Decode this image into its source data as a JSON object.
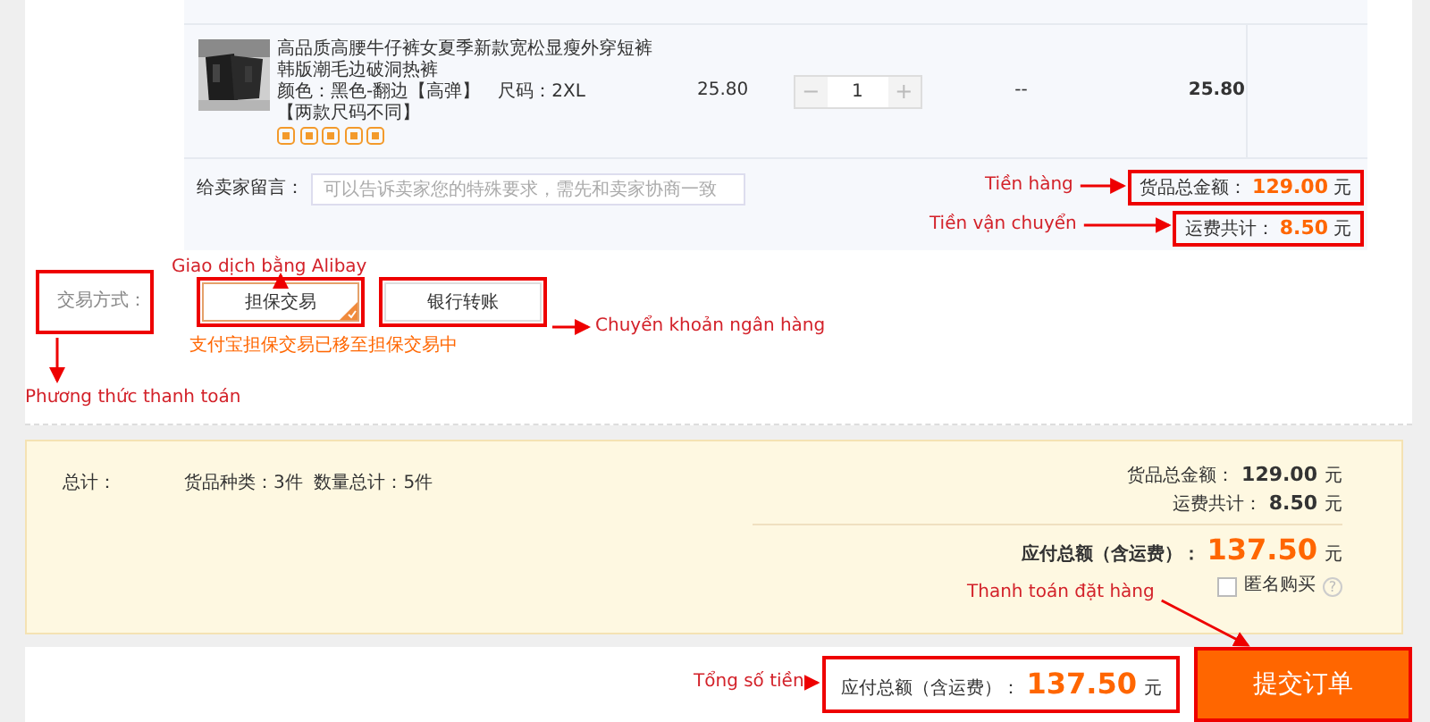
{
  "product": {
    "title": "高品质高腰牛仔裤女夏季新款宽松显瘦外穿短裤韩版潮毛边破洞热裤",
    "color_attr": "颜色：黑色-翻边【高弹】",
    "size_attr": "尺码：2XL",
    "note": "【两款尺码不同】",
    "price": "25.80",
    "quantity": "1",
    "minus": "−",
    "plus": "+",
    "discount": "--",
    "subtotal": "25.80"
  },
  "message": {
    "label": "给卖家留言：",
    "placeholder": "可以告诉卖家您的特殊要求，需先和卖家协商一致"
  },
  "order_totals": [
    {
      "label": "货品总金额：",
      "amount": "129.00",
      "unit": "元"
    },
    {
      "label": "运费共计：",
      "amount": "8.50",
      "unit": "元"
    }
  ],
  "payment": {
    "label": "交易方式：",
    "options": [
      {
        "label": "担保交易",
        "selected": true
      },
      {
        "label": "银行转账",
        "selected": false
      }
    ],
    "note": "支付宝担保交易已移至担保交易中"
  },
  "summary": {
    "label": "总计：",
    "counts": "货品种类：3件  数量总计：5件",
    "lines": [
      {
        "label": "货品总金额：",
        "amount": "129.00",
        "unit": "元"
      },
      {
        "label": "运费共计：",
        "amount": "8.50",
        "unit": "元"
      }
    ],
    "total": {
      "label": "应付总额（含运费）：",
      "amount": "137.50",
      "unit": "元"
    },
    "anonymous": {
      "label": "匿名购买",
      "checked": false,
      "help": "?"
    }
  },
  "footer": {
    "total_label": "应付总额（含运费）：",
    "total_amount": "137.50",
    "total_unit": "元",
    "submit": "提交订单"
  },
  "annotations": [
    {
      "text": "Tiền hàng"
    },
    {
      "text": "Tiền vận chuyển"
    },
    {
      "text": "Giao dịch bằng Alibay"
    },
    {
      "text": "Chuyển khoản ngân hàng"
    },
    {
      "text": "Phương thức thanh toán"
    },
    {
      "text": "Thanh toán đặt hàng"
    },
    {
      "text": "Tổng số tiền"
    }
  ]
}
